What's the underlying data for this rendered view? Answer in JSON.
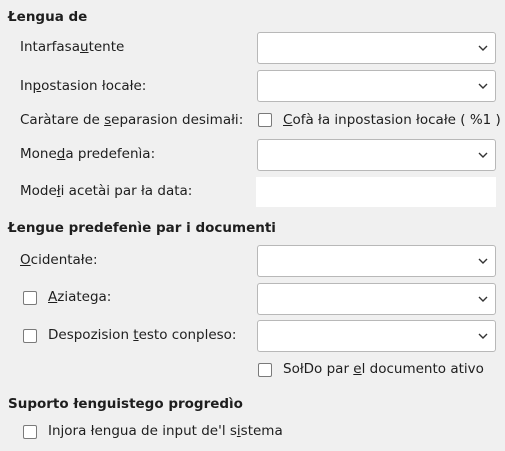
{
  "language_of": {
    "title": "Łengua de",
    "ui_label_pre": "Intarfasa",
    "ui_label_u": "u",
    "ui_label_post": "tente",
    "locale_label_pre": "In",
    "locale_label_u": "p",
    "locale_label_post": "ostasion łocałe:",
    "decimal_label_pre": "Caràtare de ",
    "decimal_label_u": "s",
    "decimal_label_post": "eparasion desimałi:",
    "decimal_checkbox_u": "C",
    "decimal_checkbox_post": "ofà ła inpostasion łocałe ( %1 )",
    "currency_label_pre": "Mone",
    "currency_label_u": "d",
    "currency_label_post": "a predefenìa:",
    "date_label_pre": "Mode",
    "date_label_u": "ł",
    "date_label_post": "i acetài par ła data:"
  },
  "default_languages": {
    "title": "Łengue predefenìe par i documenti",
    "western_u": "O",
    "western_post": "cidentałe:",
    "asian_u": "A",
    "asian_post": "ziatega:",
    "ctl_pre": "Despozision ",
    "ctl_u": "t",
    "ctl_post": "esto conpleso:",
    "current_doc_pre": "SołDo par ",
    "current_doc_u": "e",
    "current_doc_post": "l documento ativo"
  },
  "enhanced": {
    "title": "Suporto łenguistego progredìo",
    "ignore_pre": "Injora łengua de input de'l s",
    "ignore_u": "i",
    "ignore_post": "stema"
  },
  "icons": {
    "dropdown": "chevron-down-icon"
  }
}
